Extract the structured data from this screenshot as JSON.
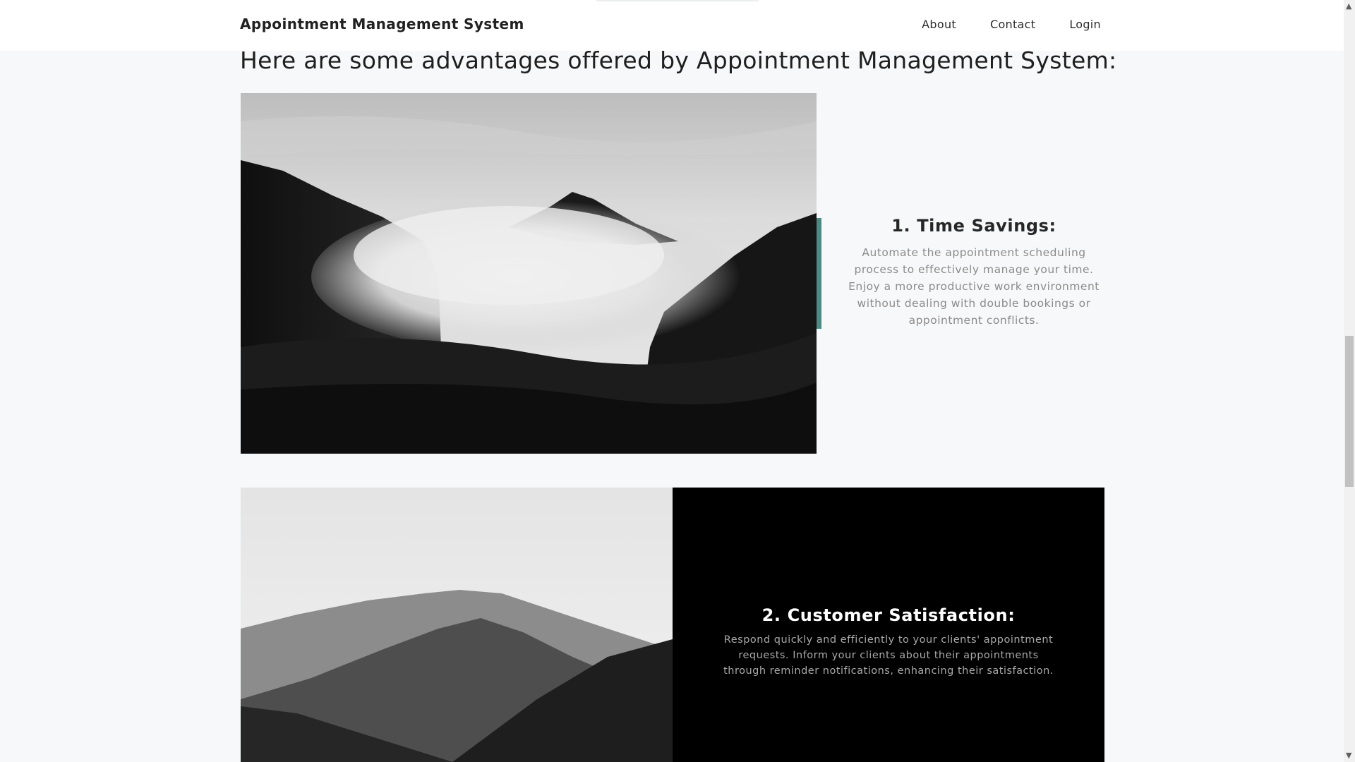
{
  "navbar": {
    "brand": "Appointment Management System",
    "links": [
      {
        "label": "About"
      },
      {
        "label": "Contact"
      },
      {
        "label": "Login"
      }
    ]
  },
  "headline": "Here are some advantages offered by Appointment Management System:",
  "features": [
    {
      "title": "1. Time Savings:",
      "description": "Automate the appointment scheduling process to effectively manage your time. Enjoy a more productive work environment without dealing with double bookings or appointment conflicts."
    },
    {
      "title": "2. Customer Satisfaction:",
      "description": "Respond quickly and efficiently to your clients' appointment requests. Inform your clients about their appointments through reminder notifications, enhancing their satisfaction."
    }
  ],
  "colors": {
    "accent": "#4d8a84",
    "page_background": "#f7f8f9",
    "dark_panel": "#000000"
  },
  "icons": {
    "scroll_up": "chevron-up-icon",
    "scroll_down": "chevron-down-icon"
  }
}
